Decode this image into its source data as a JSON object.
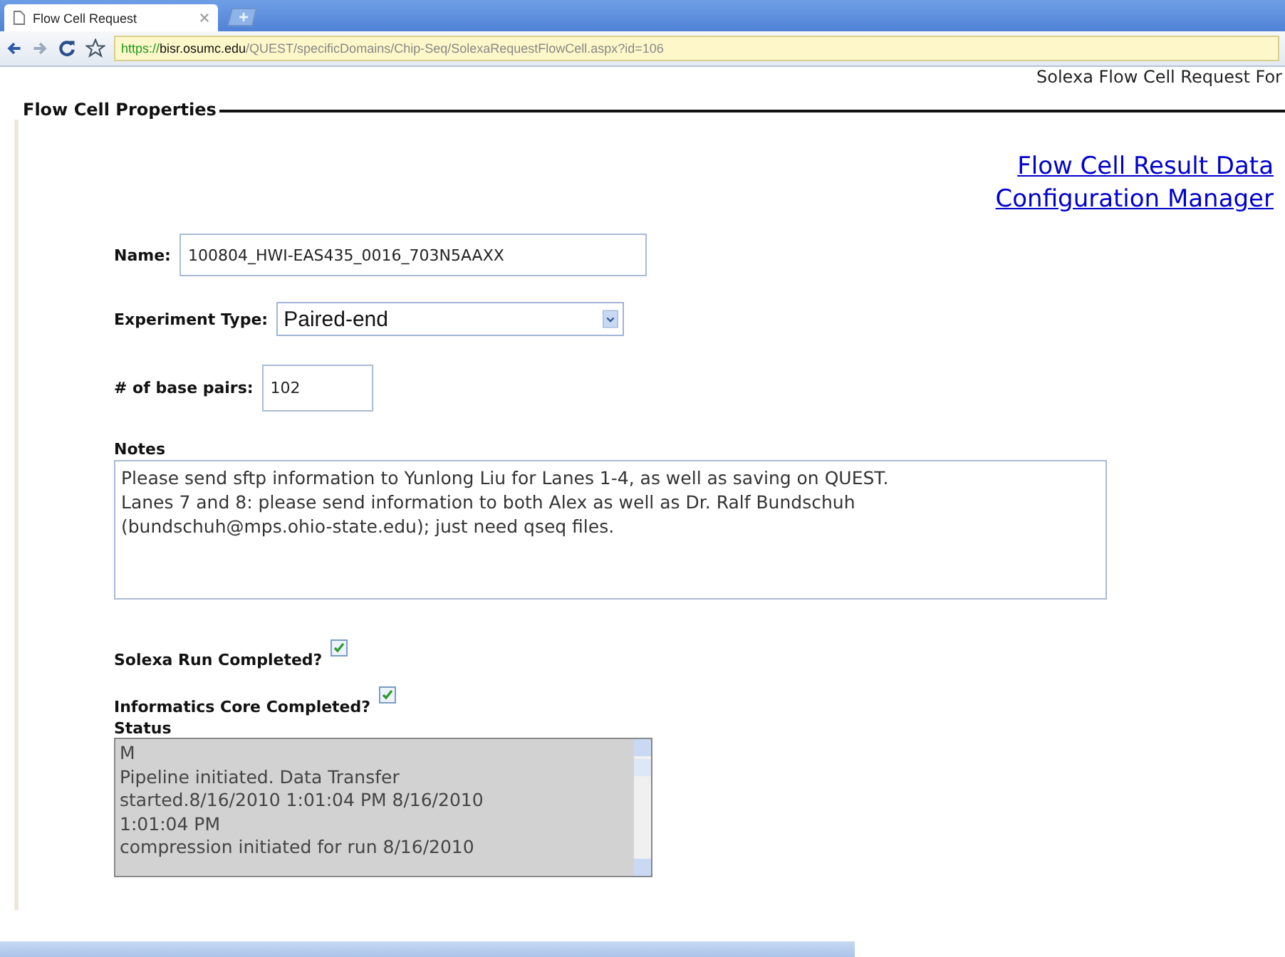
{
  "browser": {
    "tabs": [
      {
        "title": "Flow Cell Request",
        "selected": true
      }
    ],
    "url": {
      "scheme": "https://",
      "host": "bisr.osumc.edu",
      "path": "/QUEST/specificDomains/Chip-Seq/SolexaRequestFlowCell.aspx?id=106"
    }
  },
  "page_heading": "Solexa Flow Cell Request For",
  "fieldset": {
    "legend": "Flow Cell Properties",
    "links": [
      "Flow Cell Result Data",
      "Configuration Manager"
    ],
    "name": {
      "label": "Name:",
      "value": "100804_HWI-EAS435_0016_703N5AAXX"
    },
    "experiment_type": {
      "label": "Experiment Type:",
      "value": "Paired-end"
    },
    "base_pairs": {
      "label": "# of base pairs:",
      "value": "102"
    },
    "notes": {
      "label": "Notes",
      "value": "Please send sftp information to Yunlong Liu for Lanes 1-4, as well as saving on QUEST.\nLanes 7 and 8: please send information to both Alex as well as Dr. Ralf Bundschuh\n(bundschuh@mps.ohio-state.edu); just need qseq files."
    },
    "checkboxes": [
      {
        "label": "Solexa Run Completed?",
        "checked": true
      },
      {
        "label": "Informatics Core Completed?",
        "checked": true
      }
    ],
    "status": {
      "label": "Status",
      "lines": [
        "M",
        "Pipeline initiated. Data Transfer",
        "started.8/16/2010 1:01:04 PM 8/16/2010",
        "1:01:04 PM",
        "compression initiated for run  8/16/2010"
      ]
    }
  }
}
